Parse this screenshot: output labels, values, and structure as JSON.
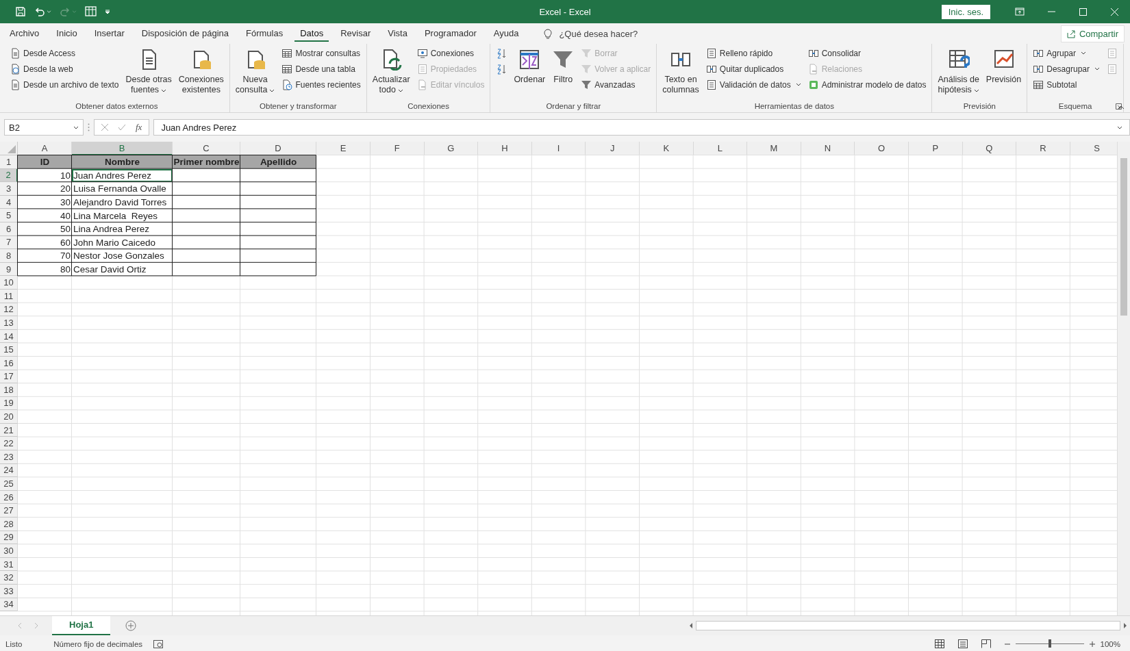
{
  "window": {
    "title": "Excel  -  Excel",
    "account_button": "Inic. ses."
  },
  "menu_tabs": [
    {
      "label": "Archivo",
      "selected": false
    },
    {
      "label": "Inicio",
      "selected": false
    },
    {
      "label": "Insertar",
      "selected": false
    },
    {
      "label": "Disposición de página",
      "selected": false
    },
    {
      "label": "Fórmulas",
      "selected": false
    },
    {
      "label": "Datos",
      "selected": true
    },
    {
      "label": "Revisar",
      "selected": false
    },
    {
      "label": "Vista",
      "selected": false
    },
    {
      "label": "Programador",
      "selected": false
    },
    {
      "label": "Ayuda",
      "selected": false
    }
  ],
  "tell_me": {
    "placeholder": "¿Qué desea hacer?"
  },
  "share_button": "Compartir",
  "ribbon_groups": [
    {
      "label": "Obtener datos externos",
      "columns": [
        {
          "kind": "stack",
          "items": [
            {
              "label": "Desde Access",
              "disabled": false
            },
            {
              "label": "Desde la web",
              "disabled": false
            },
            {
              "label": "Desde un archivo de texto",
              "disabled": false
            }
          ]
        },
        {
          "kind": "large",
          "lines": [
            "Desde otras",
            "fuentes"
          ],
          "dropdown": true
        },
        {
          "kind": "large",
          "lines": [
            "Conexiones",
            "existentes"
          ],
          "dropdown": false
        }
      ]
    },
    {
      "label": "Obtener y transformar",
      "columns": [
        {
          "kind": "large",
          "lines": [
            "Nueva",
            "consulta"
          ],
          "dropdown": true
        },
        {
          "kind": "stack",
          "items": [
            {
              "label": "Mostrar consultas",
              "disabled": false
            },
            {
              "label": "Desde una tabla",
              "disabled": false
            },
            {
              "label": "Fuentes recientes",
              "disabled": false
            }
          ]
        }
      ]
    },
    {
      "label": "Conexiones",
      "columns": [
        {
          "kind": "large",
          "lines": [
            "Actualizar",
            "todo"
          ],
          "dropdown": true
        },
        {
          "kind": "stack",
          "items": [
            {
              "label": "Conexiones",
              "disabled": false
            },
            {
              "label": "Propiedades",
              "disabled": true
            },
            {
              "label": "Editar vínculos",
              "disabled": true
            }
          ]
        }
      ]
    },
    {
      "label": "Ordenar y filtrar",
      "columns": [
        {
          "kind": "stack",
          "items": [
            {
              "disabled": false
            },
            {
              "disabled": false
            }
          ]
        },
        {
          "kind": "large",
          "lines": [
            "Ordenar"
          ],
          "dropdown": false
        },
        {
          "kind": "large",
          "lines": [
            "Filtro"
          ],
          "dropdown": false
        },
        {
          "kind": "stack",
          "items": [
            {
              "label": "Borrar",
              "disabled": true
            },
            {
              "label": "Volver a aplicar",
              "disabled": true
            },
            {
              "label": "Avanzadas",
              "disabled": false
            }
          ]
        }
      ]
    },
    {
      "label": "Herramientas de datos",
      "columns": [
        {
          "kind": "large",
          "lines": [
            "Texto en",
            "columnas"
          ],
          "dropdown": false
        },
        {
          "kind": "stack",
          "items": [
            {
              "label": "Relleno rápido",
              "disabled": false
            },
            {
              "label": "Quitar duplicados",
              "disabled": false
            },
            {
              "label": "Validación de datos",
              "disabled": false,
              "dropdown": true
            }
          ]
        },
        {
          "kind": "stack",
          "items": [
            {
              "label": "Consolidar",
              "disabled": false
            },
            {
              "label": "Relaciones",
              "disabled": true
            },
            {
              "label": "Administrar modelo de datos",
              "disabled": false
            }
          ]
        }
      ]
    },
    {
      "label": "Previsión",
      "columns": [
        {
          "kind": "large",
          "lines": [
            "Análisis de",
            "hipótesis"
          ],
          "dropdown": true
        },
        {
          "kind": "large",
          "lines": [
            "Previsión"
          ],
          "dropdown": false
        }
      ]
    },
    {
      "label": "Esquema",
      "launcher": true,
      "columns": [
        {
          "kind": "stack",
          "items": [
            {
              "label": "Agrupar",
              "disabled": false,
              "dropdown": true
            },
            {
              "label": "Desagrupar",
              "disabled": false,
              "dropdown": true
            },
            {
              "label": "Subtotal",
              "disabled": false
            }
          ]
        },
        {
          "kind": "stack",
          "items": [
            {
              "disabled": true
            },
            {
              "disabled": true
            }
          ]
        }
      ]
    }
  ],
  "formula_bar": {
    "name_box": "B2",
    "function_button": "fx",
    "value": "Juan Andres Perez"
  },
  "sheet": {
    "columns": [
      {
        "label": "A",
        "selected": false
      },
      {
        "label": "B",
        "selected": true
      },
      {
        "label": "C",
        "selected": false
      },
      {
        "label": "D",
        "selected": false
      },
      {
        "label": "E",
        "selected": false
      },
      {
        "label": "F",
        "selected": false
      },
      {
        "label": "G",
        "selected": false
      },
      {
        "label": "H",
        "selected": false
      },
      {
        "label": "I",
        "selected": false
      },
      {
        "label": "J",
        "selected": false
      },
      {
        "label": "K",
        "selected": false
      },
      {
        "label": "L",
        "selected": false
      },
      {
        "label": "M",
        "selected": false
      },
      {
        "label": "N",
        "selected": false
      },
      {
        "label": "O",
        "selected": false
      },
      {
        "label": "P",
        "selected": false
      },
      {
        "label": "Q",
        "selected": false
      },
      {
        "label": "R",
        "selected": false
      },
      {
        "label": "S",
        "selected": false
      }
    ],
    "rows": [
      {
        "label": "1",
        "selected": false,
        "kind": "header",
        "cells": [
          "ID",
          "Nombre",
          "Primer nombre",
          "Apellido"
        ]
      },
      {
        "label": "2",
        "selected": true,
        "kind": "data",
        "cells": [
          "10",
          "Juan Andres Perez"
        ]
      },
      {
        "label": "3",
        "selected": false,
        "kind": "data",
        "cells": [
          "20",
          "Luisa Fernanda Ovalle"
        ]
      },
      {
        "label": "4",
        "selected": false,
        "kind": "data",
        "cells": [
          "30",
          "Alejandro David Torres"
        ]
      },
      {
        "label": "5",
        "selected": false,
        "kind": "data",
        "cells": [
          "40",
          "Lina Marcela  Reyes"
        ]
      },
      {
        "label": "6",
        "selected": false,
        "kind": "data",
        "cells": [
          "50",
          "Lina Andrea Perez"
        ]
      },
      {
        "label": "7",
        "selected": false,
        "kind": "data",
        "cells": [
          "60",
          "John Mario Caicedo"
        ]
      },
      {
        "label": "8",
        "selected": false,
        "kind": "data",
        "cells": [
          "70",
          "Nestor Jose Gonzales"
        ]
      },
      {
        "label": "9",
        "selected": false,
        "kind": "data",
        "cells": [
          "80",
          "Cesar David Ortiz"
        ]
      },
      {
        "label": "10",
        "selected": false
      },
      {
        "label": "11",
        "selected": false
      },
      {
        "label": "12",
        "selected": false
      },
      {
        "label": "13",
        "selected": false
      },
      {
        "label": "14",
        "selected": false
      },
      {
        "label": "15",
        "selected": false
      },
      {
        "label": "16",
        "selected": false
      },
      {
        "label": "17",
        "selected": false
      },
      {
        "label": "18",
        "selected": false
      },
      {
        "label": "19",
        "selected": false
      },
      {
        "label": "20",
        "selected": false
      },
      {
        "label": "21",
        "selected": false
      },
      {
        "label": "22",
        "selected": false
      },
      {
        "label": "23",
        "selected": false
      },
      {
        "label": "24",
        "selected": false
      },
      {
        "label": "25",
        "selected": false
      },
      {
        "label": "26",
        "selected": false
      },
      {
        "label": "27",
        "selected": false
      },
      {
        "label": "28",
        "selected": false
      },
      {
        "label": "29",
        "selected": false
      },
      {
        "label": "30",
        "selected": false
      },
      {
        "label": "31",
        "selected": false
      },
      {
        "label": "32",
        "selected": false
      },
      {
        "label": "33",
        "selected": false
      },
      {
        "label": "34",
        "selected": false
      }
    ]
  },
  "sheet_tabs": [
    {
      "label": "Hoja1",
      "selected": true
    }
  ],
  "status_bar": {
    "mode": "Listo",
    "indicator": "Número fijo de decimales",
    "zoom": {
      "level": 0.5,
      "reading": "100%"
    }
  }
}
